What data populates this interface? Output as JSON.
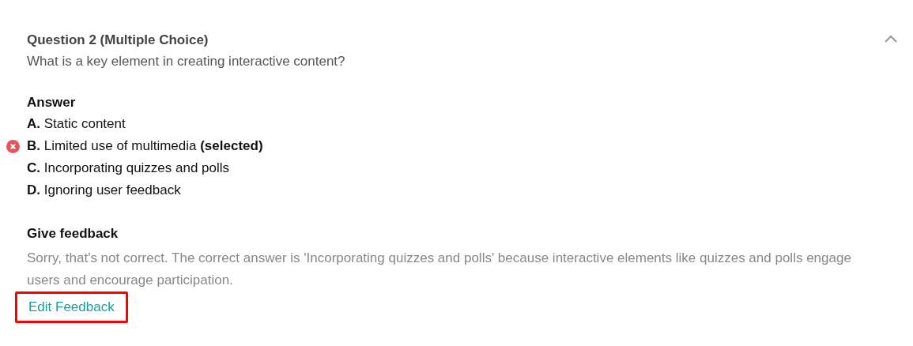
{
  "question": {
    "title": "Question 2 (Multiple Choice)",
    "prompt": "What is a key element in creating interactive content?",
    "expanded": true
  },
  "answer": {
    "heading": "Answer",
    "options": [
      {
        "text": "**A.** Static content",
        "selected": false
      },
      {
        "text": "**B.** Limited use of multimedia **(selected)**",
        "selected": true
      },
      {
        "text": "**C.** Incorporating quizzes and polls",
        "selected": false
      },
      {
        "text": "**D.** Ignoring user feedback",
        "selected": false
      }
    ]
  },
  "feedback": {
    "heading": "Give feedback",
    "text": "Sorry, that's not correct. The correct answer is 'Incorporating quizzes and polls' because interactive elements like quizzes and polls engage users and encourage participation.",
    "link": "Edit Feedback",
    "highlighted": true
  }
}
